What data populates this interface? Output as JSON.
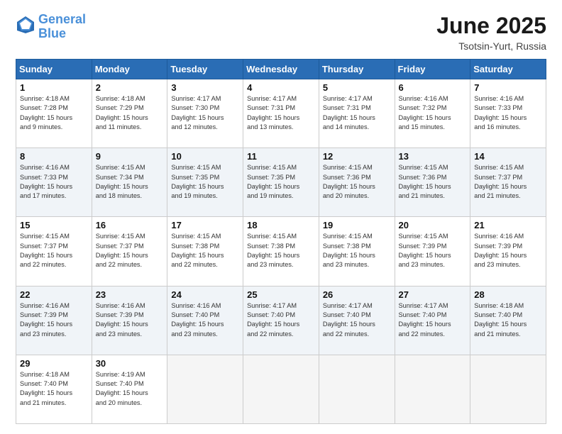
{
  "logo": {
    "text1": "General",
    "text2": "Blue"
  },
  "title": {
    "month": "June 2025",
    "location": "Tsotsin-Yurt, Russia"
  },
  "weekdays": [
    "Sunday",
    "Monday",
    "Tuesday",
    "Wednesday",
    "Thursday",
    "Friday",
    "Saturday"
  ],
  "weeks": [
    [
      {
        "day": "1",
        "lines": [
          "Sunrise: 4:18 AM",
          "Sunset: 7:28 PM",
          "Daylight: 15 hours",
          "and 9 minutes."
        ]
      },
      {
        "day": "2",
        "lines": [
          "Sunrise: 4:18 AM",
          "Sunset: 7:29 PM",
          "Daylight: 15 hours",
          "and 11 minutes."
        ]
      },
      {
        "day": "3",
        "lines": [
          "Sunrise: 4:17 AM",
          "Sunset: 7:30 PM",
          "Daylight: 15 hours",
          "and 12 minutes."
        ]
      },
      {
        "day": "4",
        "lines": [
          "Sunrise: 4:17 AM",
          "Sunset: 7:31 PM",
          "Daylight: 15 hours",
          "and 13 minutes."
        ]
      },
      {
        "day": "5",
        "lines": [
          "Sunrise: 4:17 AM",
          "Sunset: 7:31 PM",
          "Daylight: 15 hours",
          "and 14 minutes."
        ]
      },
      {
        "day": "6",
        "lines": [
          "Sunrise: 4:16 AM",
          "Sunset: 7:32 PM",
          "Daylight: 15 hours",
          "and 15 minutes."
        ]
      },
      {
        "day": "7",
        "lines": [
          "Sunrise: 4:16 AM",
          "Sunset: 7:33 PM",
          "Daylight: 15 hours",
          "and 16 minutes."
        ]
      }
    ],
    [
      {
        "day": "8",
        "lines": [
          "Sunrise: 4:16 AM",
          "Sunset: 7:33 PM",
          "Daylight: 15 hours",
          "and 17 minutes."
        ]
      },
      {
        "day": "9",
        "lines": [
          "Sunrise: 4:15 AM",
          "Sunset: 7:34 PM",
          "Daylight: 15 hours",
          "and 18 minutes."
        ]
      },
      {
        "day": "10",
        "lines": [
          "Sunrise: 4:15 AM",
          "Sunset: 7:35 PM",
          "Daylight: 15 hours",
          "and 19 minutes."
        ]
      },
      {
        "day": "11",
        "lines": [
          "Sunrise: 4:15 AM",
          "Sunset: 7:35 PM",
          "Daylight: 15 hours",
          "and 19 minutes."
        ]
      },
      {
        "day": "12",
        "lines": [
          "Sunrise: 4:15 AM",
          "Sunset: 7:36 PM",
          "Daylight: 15 hours",
          "and 20 minutes."
        ]
      },
      {
        "day": "13",
        "lines": [
          "Sunrise: 4:15 AM",
          "Sunset: 7:36 PM",
          "Daylight: 15 hours",
          "and 21 minutes."
        ]
      },
      {
        "day": "14",
        "lines": [
          "Sunrise: 4:15 AM",
          "Sunset: 7:37 PM",
          "Daylight: 15 hours",
          "and 21 minutes."
        ]
      }
    ],
    [
      {
        "day": "15",
        "lines": [
          "Sunrise: 4:15 AM",
          "Sunset: 7:37 PM",
          "Daylight: 15 hours",
          "and 22 minutes."
        ]
      },
      {
        "day": "16",
        "lines": [
          "Sunrise: 4:15 AM",
          "Sunset: 7:37 PM",
          "Daylight: 15 hours",
          "and 22 minutes."
        ]
      },
      {
        "day": "17",
        "lines": [
          "Sunrise: 4:15 AM",
          "Sunset: 7:38 PM",
          "Daylight: 15 hours",
          "and 22 minutes."
        ]
      },
      {
        "day": "18",
        "lines": [
          "Sunrise: 4:15 AM",
          "Sunset: 7:38 PM",
          "Daylight: 15 hours",
          "and 23 minutes."
        ]
      },
      {
        "day": "19",
        "lines": [
          "Sunrise: 4:15 AM",
          "Sunset: 7:38 PM",
          "Daylight: 15 hours",
          "and 23 minutes."
        ]
      },
      {
        "day": "20",
        "lines": [
          "Sunrise: 4:15 AM",
          "Sunset: 7:39 PM",
          "Daylight: 15 hours",
          "and 23 minutes."
        ]
      },
      {
        "day": "21",
        "lines": [
          "Sunrise: 4:16 AM",
          "Sunset: 7:39 PM",
          "Daylight: 15 hours",
          "and 23 minutes."
        ]
      }
    ],
    [
      {
        "day": "22",
        "lines": [
          "Sunrise: 4:16 AM",
          "Sunset: 7:39 PM",
          "Daylight: 15 hours",
          "and 23 minutes."
        ]
      },
      {
        "day": "23",
        "lines": [
          "Sunrise: 4:16 AM",
          "Sunset: 7:39 PM",
          "Daylight: 15 hours",
          "and 23 minutes."
        ]
      },
      {
        "day": "24",
        "lines": [
          "Sunrise: 4:16 AM",
          "Sunset: 7:40 PM",
          "Daylight: 15 hours",
          "and 23 minutes."
        ]
      },
      {
        "day": "25",
        "lines": [
          "Sunrise: 4:17 AM",
          "Sunset: 7:40 PM",
          "Daylight: 15 hours",
          "and 22 minutes."
        ]
      },
      {
        "day": "26",
        "lines": [
          "Sunrise: 4:17 AM",
          "Sunset: 7:40 PM",
          "Daylight: 15 hours",
          "and 22 minutes."
        ]
      },
      {
        "day": "27",
        "lines": [
          "Sunrise: 4:17 AM",
          "Sunset: 7:40 PM",
          "Daylight: 15 hours",
          "and 22 minutes."
        ]
      },
      {
        "day": "28",
        "lines": [
          "Sunrise: 4:18 AM",
          "Sunset: 7:40 PM",
          "Daylight: 15 hours",
          "and 21 minutes."
        ]
      }
    ],
    [
      {
        "day": "29",
        "lines": [
          "Sunrise: 4:18 AM",
          "Sunset: 7:40 PM",
          "Daylight: 15 hours",
          "and 21 minutes."
        ]
      },
      {
        "day": "30",
        "lines": [
          "Sunrise: 4:19 AM",
          "Sunset: 7:40 PM",
          "Daylight: 15 hours",
          "and 20 minutes."
        ]
      },
      {
        "day": "",
        "lines": []
      },
      {
        "day": "",
        "lines": []
      },
      {
        "day": "",
        "lines": []
      },
      {
        "day": "",
        "lines": []
      },
      {
        "day": "",
        "lines": []
      }
    ]
  ]
}
